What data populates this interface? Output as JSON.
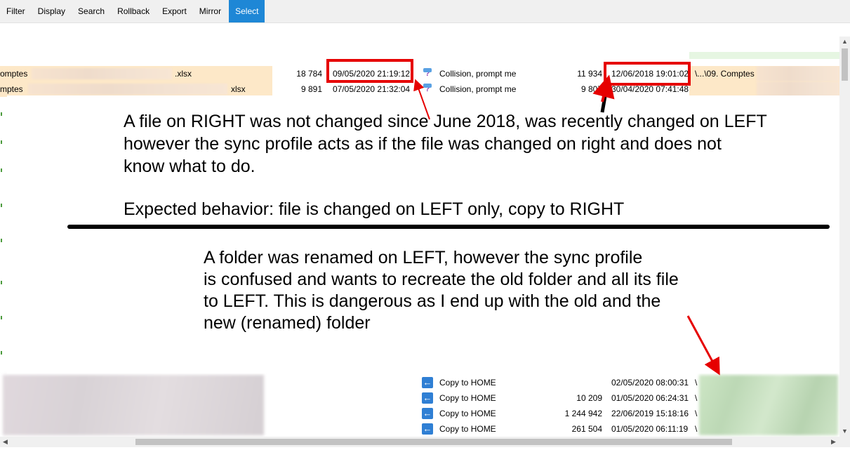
{
  "menu": {
    "items": [
      {
        "label": "Filter",
        "active": false
      },
      {
        "label": "Display",
        "active": false
      },
      {
        "label": "Search",
        "active": false
      },
      {
        "label": "Rollback",
        "active": false
      },
      {
        "label": "Export",
        "active": false
      },
      {
        "label": "Mirror",
        "active": false
      },
      {
        "label": "Select",
        "active": true
      }
    ],
    "active_color": "#1e87d6"
  },
  "rows_top": [
    {
      "name_prefix": "omptes",
      "name_suffix": ".xlsx",
      "left_size": "18 784",
      "left_date": "09/05/2020 21:19:12",
      "action_icon": "collision-icon",
      "action": "Collision, prompt me",
      "right_size": "11 934",
      "right_date": "12/06/2018 19:01:02",
      "right_path": "\\...\\09. Comptes"
    },
    {
      "name_prefix": "mptes",
      "name_suffix": "xlsx",
      "left_size": "9 891",
      "left_date": "07/05/2020 21:32:04",
      "action_icon": "collision-icon",
      "action": "Collision, prompt me",
      "right_size": "9 807",
      "right_date": "30/04/2020 07:41:48",
      "right_path": ""
    }
  ],
  "rows_bottom": [
    {
      "action_icon": "copy-to-home-icon",
      "action": "Copy to HOME",
      "right_size": "",
      "right_date": "02/05/2020 08:00:31",
      "right_path": "\\"
    },
    {
      "action_icon": "copy-to-home-icon",
      "action": "Copy to HOME",
      "right_size": "10 209",
      "right_date": "01/05/2020 06:24:31",
      "right_path": "\\"
    },
    {
      "action_icon": "copy-to-home-icon",
      "action": "Copy to HOME",
      "right_size": "1 244 942",
      "right_date": "22/06/2019 15:18:16",
      "right_path": "\\"
    },
    {
      "action_icon": "copy-to-home-icon",
      "action": "Copy to HOME",
      "right_size": "261 504",
      "right_date": "01/05/2020 06:11:19",
      "right_path": "\\"
    }
  ],
  "annotations": {
    "note_1": "A file on RIGHT was not changed since June 2018, was recently changed on LEFT\nhowever the sync profile acts as if the file was changed on right and does not\nknow what to do.",
    "note_2": "Expected behavior: file is changed on LEFT only, copy to RIGHT",
    "note_3": "A folder was renamed on LEFT, however the sync profile\nis confused and wants to recreate the old folder and all its file\nto LEFT. This is dangerous as I end up with the old and the\nnew (renamed) folder",
    "highlight_color": "#e60000"
  },
  "scrollbar": {
    "up_arrow": "▲",
    "down_arrow": "▼",
    "left_arrow": "◀",
    "right_arrow": "▶"
  }
}
